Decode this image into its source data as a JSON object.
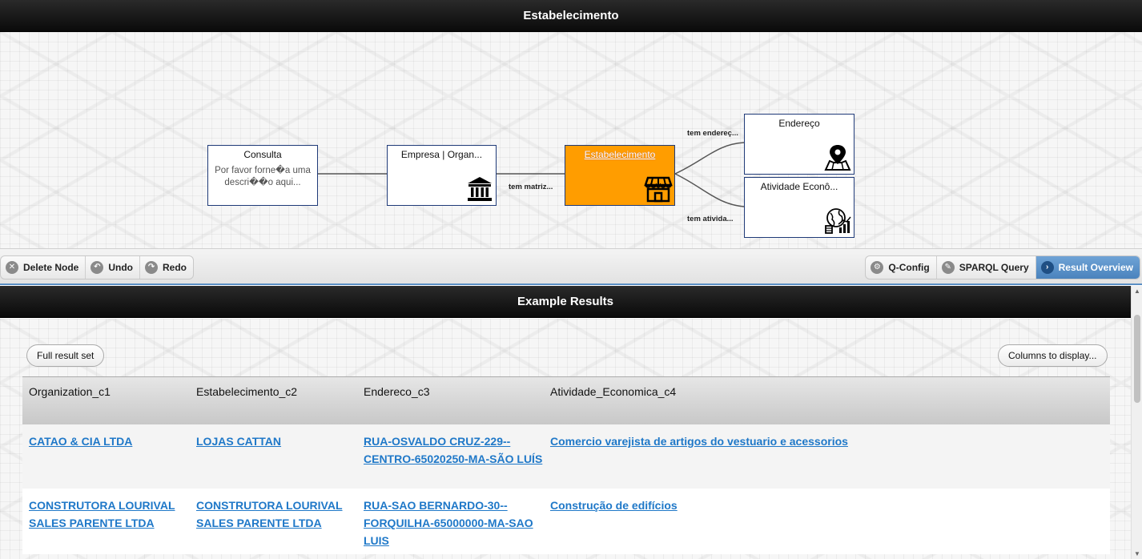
{
  "top_header": {
    "title": "Estabelecimento"
  },
  "graph": {
    "nodes": [
      {
        "id": "consulta",
        "title": "Consulta",
        "desc": "Por favor forne�a uma descri��o aqui...",
        "icon": ""
      },
      {
        "id": "empresa",
        "title": "Empresa | Organ...",
        "desc": "",
        "icon": "bank-icon"
      },
      {
        "id": "estabelecimento",
        "title": "Estabelecimento",
        "desc": "",
        "icon": "store-icon",
        "selected": true
      },
      {
        "id": "endereco",
        "title": "Endereço",
        "desc": "",
        "icon": "map-pin-icon"
      },
      {
        "id": "atividade",
        "title": "Atividade Econô...",
        "desc": "",
        "icon": "economy-globe-icon"
      }
    ],
    "edges": [
      {
        "from": "consulta",
        "to": "empresa",
        "label": ""
      },
      {
        "from": "empresa",
        "to": "estabelecimento",
        "label": "tem matriz..."
      },
      {
        "from": "estabelecimento",
        "to": "endereco",
        "label": "tem endereç..."
      },
      {
        "from": "estabelecimento",
        "to": "atividade",
        "label": "tem ativida..."
      }
    ],
    "accent_color": "#ff9d00",
    "border_color": "#1f3a78"
  },
  "toolbar": {
    "left": [
      {
        "label": "Delete Node",
        "icon": "close-circle-icon"
      },
      {
        "label": "Undo",
        "icon": "undo-icon"
      },
      {
        "label": "Redo",
        "icon": "redo-icon"
      }
    ],
    "right": [
      {
        "label": "Q-Config",
        "icon": "gear-icon",
        "active": false
      },
      {
        "label": "SPARQL Query",
        "icon": "pencil-icon",
        "active": false
      },
      {
        "label": "Result Overview",
        "icon": "chevron-right-icon",
        "active": true
      }
    ]
  },
  "results": {
    "title": "Example Results",
    "full_result_label": "Full result set",
    "columns_label": "Columns to display...",
    "columns": [
      "Organization_c1",
      "Estabelecimento_c2",
      "Endereco_c3",
      "Atividade_Economica_c4"
    ],
    "rows": [
      [
        "CATAO & CIA LTDA",
        "LOJAS CATTAN",
        "RUA-OSVALDO CRUZ-229--CENTRO-65020250-MA-SÃO LUÍS",
        "Comercio varejista de artigos do vestuario e acessorios"
      ],
      [
        "CONSTRUTORA LOURIVAL SALES PARENTE LTDA",
        "CONSTRUTORA LOURIVAL SALES PARENTE LTDA",
        "RUA-SAO BERNARDO-30--FORQUILHA-65000000-MA-SAO LUIS",
        "Construção de edifícios"
      ]
    ]
  }
}
